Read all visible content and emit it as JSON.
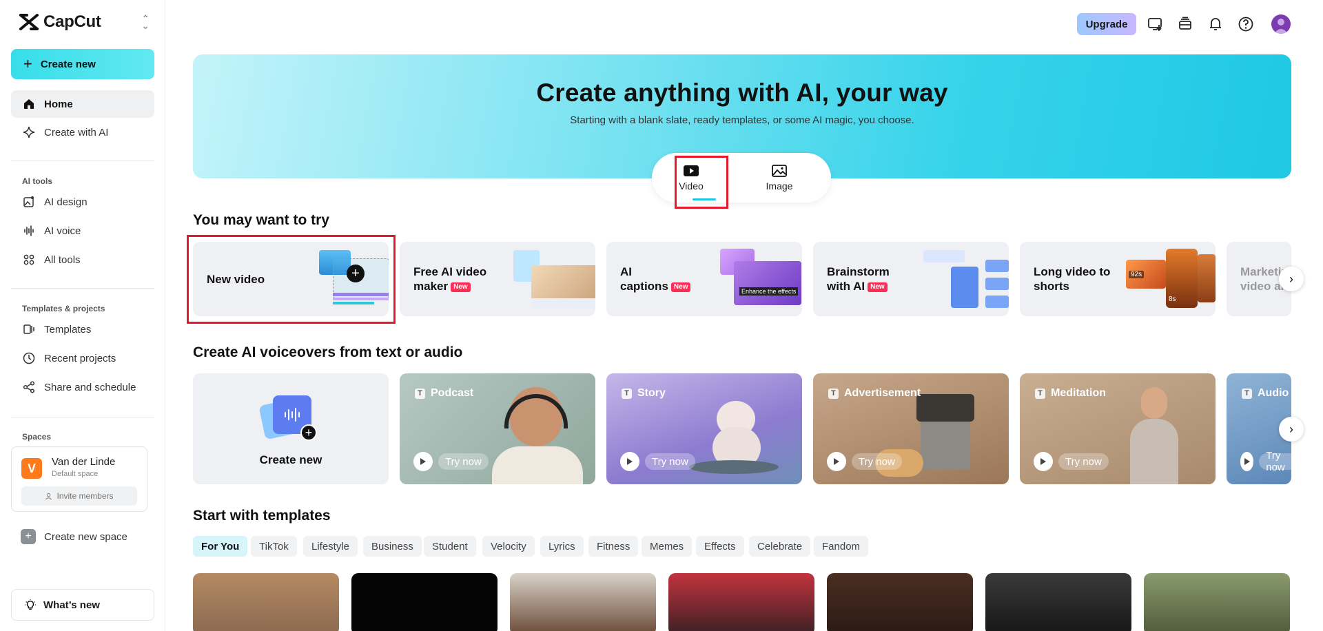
{
  "sidebar": {
    "brand": "CapCut",
    "create_new": "Create new",
    "nav": [
      {
        "label": "Home"
      },
      {
        "label": "Create with AI"
      }
    ],
    "ai_tools_label": "AI tools",
    "ai_tools": [
      {
        "label": "AI design"
      },
      {
        "label": "AI voice"
      },
      {
        "label": "All tools"
      }
    ],
    "templates_label": "Templates & projects",
    "templates_items": [
      {
        "label": "Templates"
      },
      {
        "label": "Recent projects"
      },
      {
        "label": "Share and schedule"
      }
    ],
    "spaces_label": "Spaces",
    "space": {
      "initial": "V",
      "name": "Van der Linde",
      "subtitle": "Default space",
      "invite": "Invite members"
    },
    "create_space": "Create new space",
    "whats_new": "What’s new"
  },
  "topbar": {
    "upgrade": "Upgrade"
  },
  "hero": {
    "title": "Create anything with AI, your way",
    "subtitle": "Starting with a blank slate, ready templates, or some AI magic, you choose.",
    "tabs": [
      {
        "label": "Video"
      },
      {
        "label": "Image"
      }
    ]
  },
  "try_section": {
    "heading": "You may want to try",
    "cards": [
      {
        "title": "New video"
      },
      {
        "title1": "Free AI video",
        "title2": "maker",
        "badge": "New"
      },
      {
        "title1": "AI",
        "title2": "captions",
        "badge": "New"
      },
      {
        "title1": "Brainstorm",
        "title2": "with AI",
        "badge": "New"
      },
      {
        "title1": "Long video to",
        "title2": "shorts",
        "tag1": "92s",
        "tag2": "8s"
      },
      {
        "title1": "Marketing",
        "title2": "video ai"
      }
    ],
    "overlay_text": "Enhance the effects"
  },
  "voice_section": {
    "heading": "Create AI voiceovers from text or audio",
    "create_new": "Create new",
    "try_now": "Try now",
    "cards": [
      {
        "label": "Podcast"
      },
      {
        "label": "Story"
      },
      {
        "label": "Advertisement"
      },
      {
        "label": "Meditation"
      },
      {
        "label": "Audio"
      }
    ]
  },
  "templates_section": {
    "heading": "Start with templates",
    "chips": [
      "For You",
      "TikTok",
      "Lifestyle",
      "Business",
      "Student",
      "Velocity",
      "Lyrics",
      "Fitness",
      "Memes",
      "Effects",
      "Celebrate",
      "Fandom"
    ]
  },
  "colors": {
    "accent": "#1fc8e4",
    "new_badge": "#ff2c55",
    "highlight_box": "#e3192c"
  }
}
